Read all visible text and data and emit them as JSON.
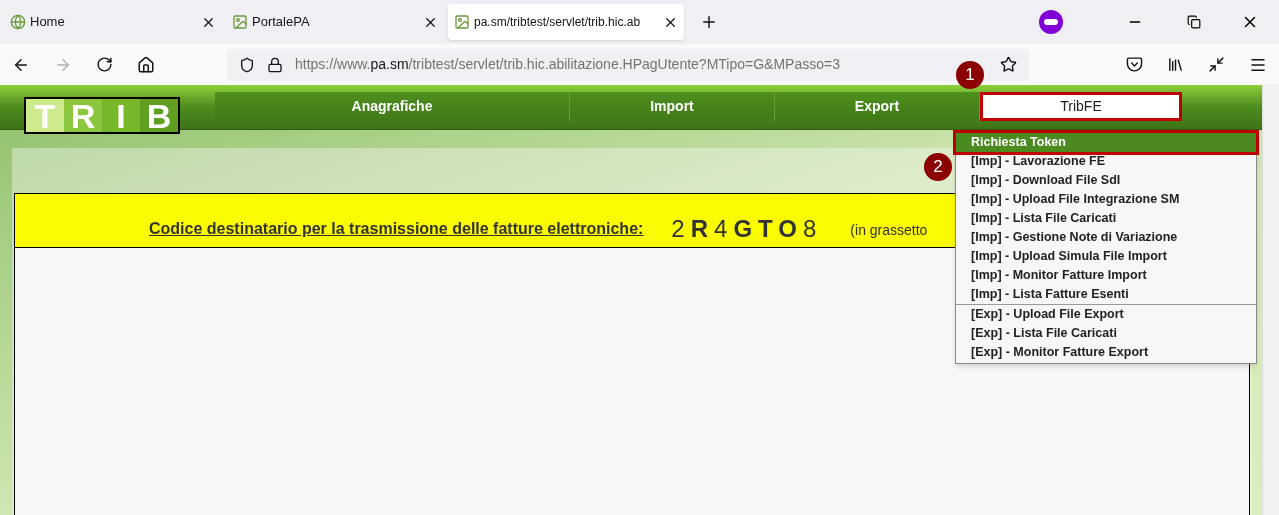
{
  "browser": {
    "tabs": [
      {
        "title": "Home",
        "selected": false
      },
      {
        "title": "PortalePA",
        "selected": false
      },
      {
        "title": "pa.sm/tribtest/servlet/trib.hic.ab",
        "selected": true
      }
    ],
    "url": {
      "domain_prefix": "https://www.",
      "domain": "pa.sm",
      "path": "/tribtest/servlet/trib.hic.abilitazione.HPagUtente?MTipo=G&MPasso=3"
    }
  },
  "header": {
    "logo_letters": [
      "T",
      "R",
      "I",
      "B"
    ],
    "nav": [
      {
        "label": "Anagrafiche",
        "selected": false
      },
      {
        "label": "Import",
        "selected": false
      },
      {
        "label": "Export",
        "selected": false
      },
      {
        "label": "TribFE",
        "selected": true
      }
    ]
  },
  "dropdown": {
    "sections": [
      {
        "items": [
          {
            "label": "Richiesta Token",
            "selected": true
          },
          {
            "label": "[Imp] - Lavorazione FE",
            "selected": false
          },
          {
            "label": "[Imp] - Download File SdI",
            "selected": false
          },
          {
            "label": "[Imp] - Upload File Integrazione SM",
            "selected": false
          },
          {
            "label": "[Imp] - Lista File Caricati",
            "selected": false
          },
          {
            "label": "[Imp] - Gestione Note di Variazione",
            "selected": false
          },
          {
            "label": "[Imp] - Upload Simula File Import",
            "selected": false
          },
          {
            "label": "[Imp] - Monitor Fatture Import",
            "selected": false
          },
          {
            "label": "[Imp] - Lista Fatture Esenti",
            "selected": false
          }
        ]
      },
      {
        "items": [
          {
            "label": "[Exp] - Upload File Export",
            "selected": false
          },
          {
            "label": "[Exp] - Lista File Caricati",
            "selected": false
          },
          {
            "label": "[Exp] - Monitor Fatture Export",
            "selected": false
          }
        ]
      }
    ]
  },
  "banner": {
    "label": "Codice destinatario per la trasmissione delle fatture elettroniche:",
    "code": [
      {
        "char": "2",
        "bold": false
      },
      {
        "char": "R",
        "bold": true
      },
      {
        "char": "4",
        "bold": false
      },
      {
        "char": "G",
        "bold": true
      },
      {
        "char": "T",
        "bold": true
      },
      {
        "char": "O",
        "bold": true
      },
      {
        "char": "8",
        "bold": false
      }
    ],
    "note": "(in grassetto"
  },
  "annotations": [
    "1",
    "2"
  ]
}
